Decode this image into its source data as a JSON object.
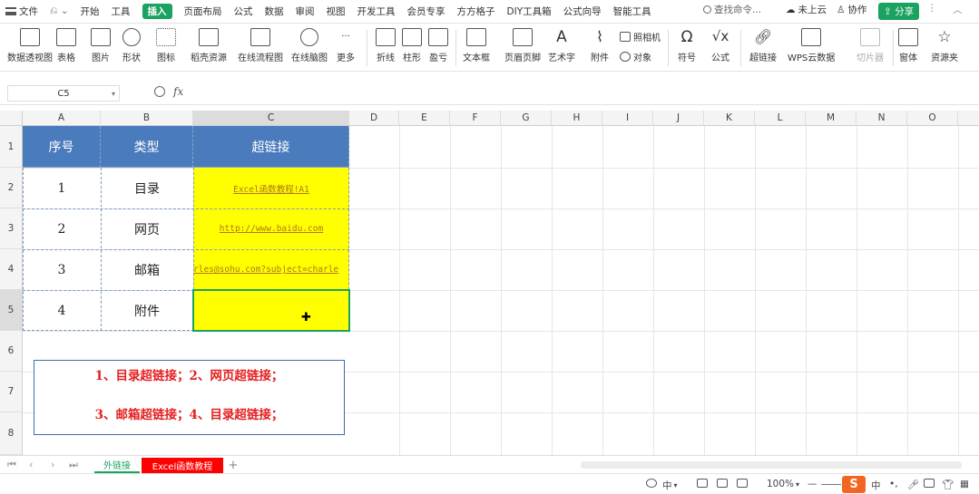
{
  "menubar": {
    "file": "文件",
    "tabs": [
      "开始",
      "工具",
      "插入",
      "页面布局",
      "公式",
      "数据",
      "审阅",
      "视图",
      "开发工具",
      "会员专享",
      "方方格子",
      "DIY工具箱",
      "公式向导",
      "智能工具"
    ],
    "active_tab": "插入",
    "search_placeholder": "查找命令...",
    "cloud": "未上云",
    "collab": "协作",
    "share": "分享"
  },
  "ribbon": {
    "items": [
      "数据透视图",
      "表格",
      "图片",
      "形状",
      "图标",
      "稻壳资源",
      "在线流程图",
      "在线脑图",
      "更多",
      "折线",
      "柱形",
      "盈亏",
      "文本框",
      "页眉页脚",
      "艺术字",
      "附件",
      "符号",
      "公式",
      "超链接",
      "WPS云数据",
      "切片器",
      "窗体",
      "资源夹"
    ],
    "small_items": [
      "照相机",
      "对象"
    ]
  },
  "formula_bar": {
    "cell_ref": "C5",
    "fx": "fx",
    "value": ""
  },
  "sheet": {
    "columns": [
      "A",
      "B",
      "C",
      "D",
      "E",
      "F",
      "G",
      "H",
      "I",
      "J",
      "K",
      "L",
      "M",
      "N",
      "O"
    ],
    "rows": [
      "1",
      "2",
      "3",
      "4",
      "5",
      "6",
      "7",
      "8"
    ],
    "selected_cell": "C5",
    "header": [
      "序号",
      "类型",
      "超链接"
    ],
    "data": [
      {
        "no": "1",
        "type": "目录",
        "link": "Excel函数教程!A1"
      },
      {
        "no": "2",
        "type": "网页",
        "link": "http://www.baidu.com"
      },
      {
        "no": "3",
        "type": "邮箱",
        "link": "rles@sohu.com?subject=charle"
      },
      {
        "no": "4",
        "type": "附件",
        "link": ""
      }
    ],
    "note": {
      "line1": "1、目录超链接；2、网页超链接；",
      "line2": "3、邮箱超链接；4、目录超链接；"
    },
    "colors": {
      "header_bg": "#4a7bbd",
      "link_bg": "#ffff00",
      "note_text": "#e41e1e",
      "accent": "#1aa260"
    }
  },
  "sheet_tabs": {
    "tabs": [
      "外链接",
      "Excel函数教程"
    ],
    "active": "外链接"
  },
  "status": {
    "ime": "中",
    "zoom": "100%",
    "ime2": "中"
  }
}
